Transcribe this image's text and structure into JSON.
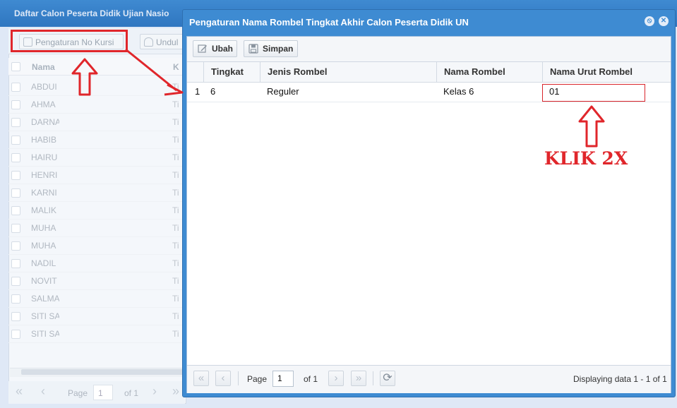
{
  "background": {
    "title": "Daftar Calon Peserta Didik Ujian Nasio",
    "toolbar": {
      "pengaturan_no_kursi": "Pengaturan No Kursi",
      "unduh": "Undul"
    },
    "column_nama": "Nama",
    "column_k": "K",
    "names": [
      "ABDUI",
      "AHMA",
      "DARNA",
      "HABIB",
      "HAIRU",
      "HENRI",
      "KARNI",
      "MALIK",
      "MUHA",
      "MUHA",
      "NADIL",
      "NOVIT",
      "SALMA",
      "SITI SA",
      "SITI SA"
    ],
    "k_values": [
      "Ti",
      "Ti",
      "Ti",
      "Ti",
      "Ti",
      "Ti",
      "Ti",
      "Ti",
      "Ti",
      "Ti",
      "Ti",
      "Ti",
      "Ti",
      "Ti",
      "Ti"
    ],
    "pager": {
      "page_label": "Page",
      "page_value": "1",
      "of_label": "of 1"
    }
  },
  "modal": {
    "title": "Pengaturan Nama Rombel Tingkat Akhir Calon Peserta Didik UN",
    "toolbar": {
      "ubah": "Ubah",
      "simpan": "Simpan"
    },
    "columns": {
      "tingkat": "Tingkat",
      "jenis_rombel": "Jenis Rombel",
      "nama_rombel": "Nama Rombel",
      "nama_urut_rombel": "Nama Urut Rombel"
    },
    "rows": [
      {
        "row_number": "1",
        "tingkat": "6",
        "jenis_rombel": "Reguler",
        "nama_rombel": "Kelas 6",
        "nama_urut_rombel": "01"
      }
    ],
    "pager": {
      "page_label": "Page",
      "page_value": "1",
      "of_label": "of 1",
      "display_info": "Displaying data 1 - 1 of 1"
    }
  },
  "annotation": {
    "klik_text": "KLIK 2X",
    "color": "#e0262b"
  },
  "colors": {
    "window_header": "#3e8bd2",
    "background": "#dfe8f6"
  }
}
